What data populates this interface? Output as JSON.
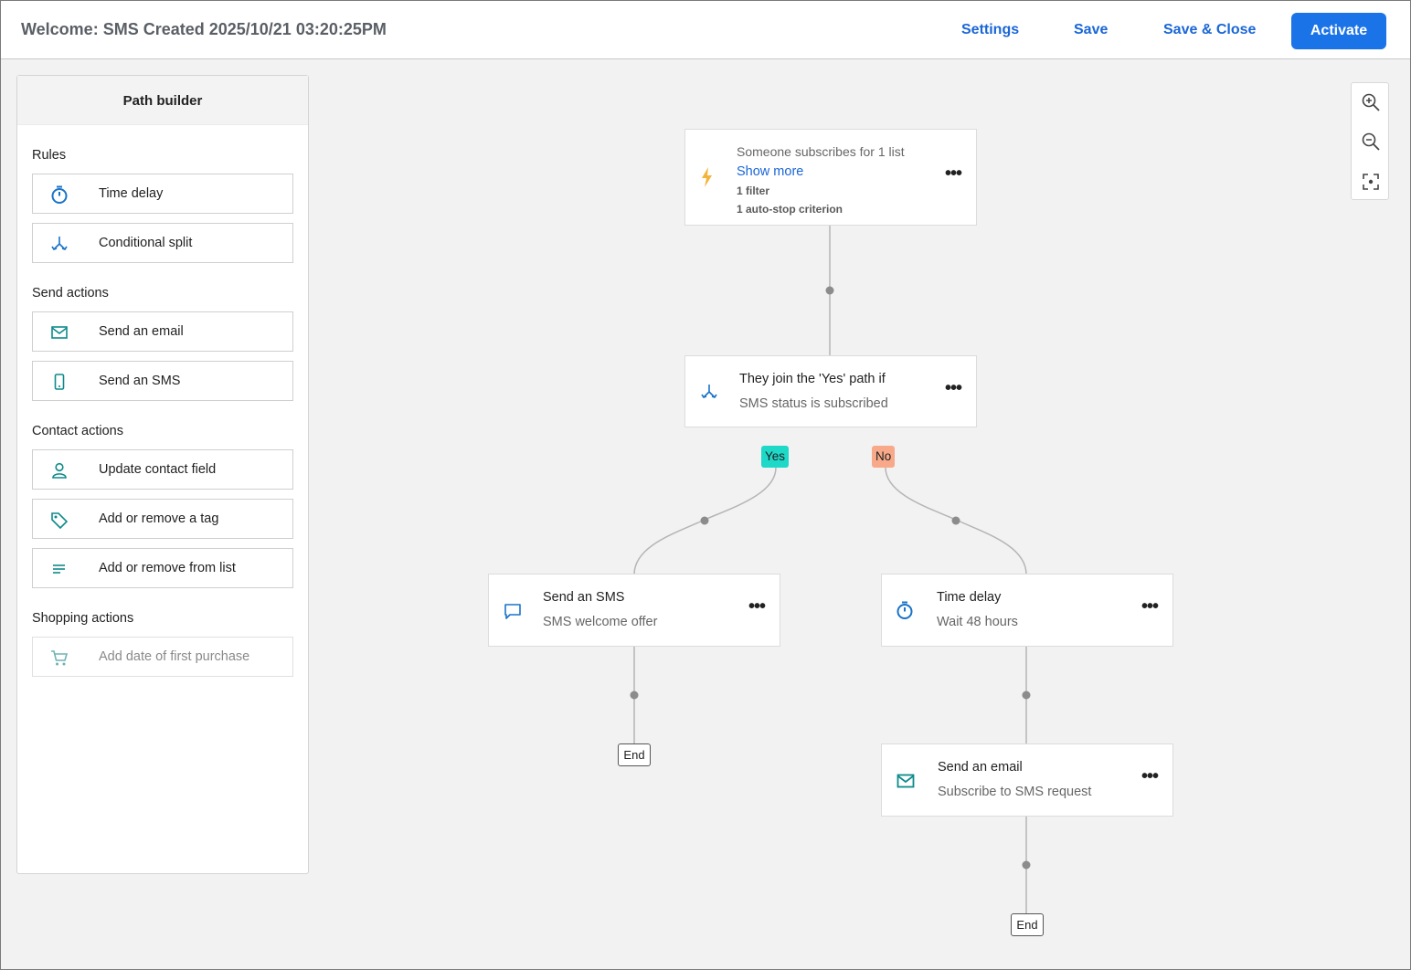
{
  "header": {
    "title": "Welcome: SMS Created 2025/10/21 03:20:25PM",
    "settings": "Settings",
    "save": "Save",
    "save_close": "Save & Close",
    "activate": "Activate"
  },
  "sidebar": {
    "title": "Path builder",
    "sections": {
      "rules": "Rules",
      "send_actions": "Send actions",
      "contact_actions": "Contact actions",
      "shopping_actions": "Shopping actions"
    },
    "items": {
      "time_delay": "Time delay",
      "conditional_split": "Conditional split",
      "send_email": "Send an email",
      "send_sms": "Send an SMS",
      "update_contact": "Update contact field",
      "add_tag": "Add or remove a tag",
      "add_list": "Add or remove from list",
      "first_purchase": "Add date of first purchase"
    }
  },
  "flow": {
    "trigger": {
      "title": "Someone subscribes for 1 list",
      "show_more": "Show more",
      "filter": "1 filter",
      "autostop": "1 auto-stop criterion"
    },
    "split": {
      "title": "They join the 'Yes' path if",
      "subtitle": "SMS status is subscribed",
      "yes": "Yes",
      "no": "No"
    },
    "sms_node": {
      "title": "Send an SMS",
      "subtitle": "SMS welcome offer"
    },
    "delay_node": {
      "title": "Time delay",
      "subtitle": "Wait 48 hours"
    },
    "email_node": {
      "title": "Send an email",
      "subtitle": "Subscribe to SMS request"
    },
    "end_label": "End",
    "more": "•••"
  },
  "colors": {
    "accent": "#1b73e8",
    "link": "#1a66d6",
    "teal_icon": "#0d8a8a",
    "trigger_icon": "#f2b43a",
    "yes_tag": "#1ed8c8",
    "no_tag": "#f7a98a"
  },
  "icons": {
    "zoom_in": "zoom-in-icon",
    "zoom_out": "zoom-out-icon",
    "fit": "fit-screen-icon"
  }
}
